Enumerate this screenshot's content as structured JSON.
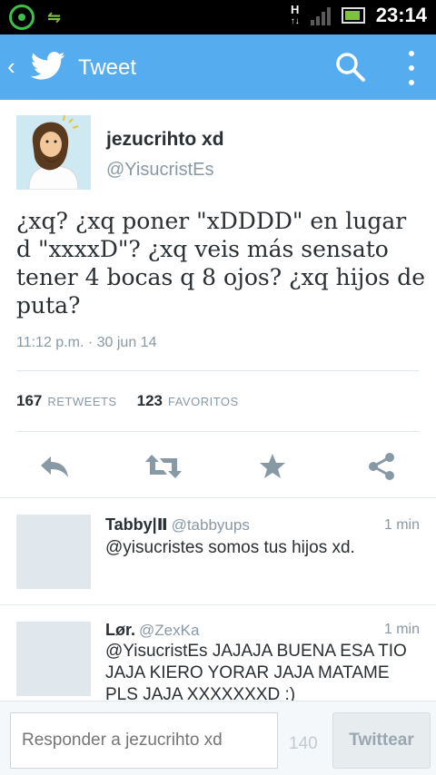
{
  "status_bar": {
    "network_type": "H",
    "clock": "23:14"
  },
  "action_bar": {
    "title": "Tweet",
    "back_glyph": "‹",
    "accent_color": "#55acee"
  },
  "tweet": {
    "author_name": "jezucrihto xd",
    "author_handle": "@YisucristEs",
    "text": "¿xq? ¿xq poner \"xDDDD\" en lugar d \"xxxxD\"? ¿xq veis más sensato tener 4 bocas q 8 ojos? ¿xq hijos de puta?",
    "timestamp": "11:12 p.m. · 30 jun 14",
    "retweets_count": "167",
    "retweets_label": "RETWEETS",
    "favorites_count": "123",
    "favorites_label": "FAVORITOS"
  },
  "actions": [
    {
      "icon": "reply-icon"
    },
    {
      "icon": "retweet-icon"
    },
    {
      "icon": "favorite-star-icon"
    },
    {
      "icon": "share-icon"
    }
  ],
  "replies": [
    {
      "name": "Tabby|Ⅱ",
      "handle": "@tabbyups",
      "time": "1 min",
      "text": "@yisucristes somos tus hijos xd."
    },
    {
      "name": "Lør.",
      "handle": "@ZexKa",
      "time": "1 min",
      "text": "@YisucristEs JAJAJA BUENA ESA TIO JAJA KIERO YORAR JAJA MATAME PLS JAJA XXXXXXXD :)"
    }
  ],
  "composer": {
    "placeholder": "Responder a jezucrihto xd",
    "char_count": "140",
    "tweet_button_label": "Twittear"
  }
}
